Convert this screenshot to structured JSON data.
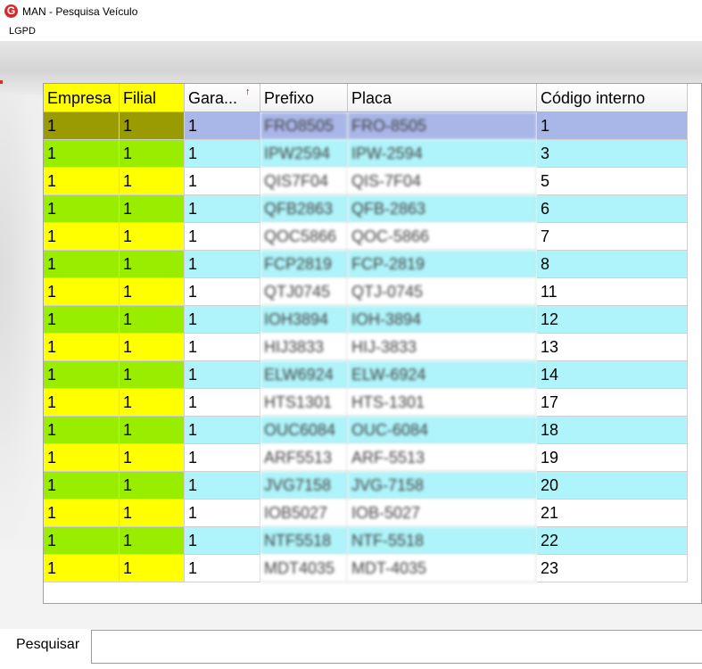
{
  "window": {
    "title": "MAN - Pesquisa Veículo",
    "icon": "app-logo-icon"
  },
  "menu": {
    "items": [
      "LGPD"
    ]
  },
  "grid": {
    "columns": [
      "Empresa",
      "Filial",
      "Gara...",
      "Prefixo",
      "Placa",
      "Código interno"
    ],
    "sorted_column": "Gara...",
    "sort_icon": "sort-ascending-icon",
    "rows": [
      {
        "empresa": "1",
        "filial": "1",
        "garagem": "1",
        "prefixo": "FRO8505",
        "placa": "FRO-8505",
        "codigo": "1"
      },
      {
        "empresa": "1",
        "filial": "1",
        "garagem": "1",
        "prefixo": "IPW2594",
        "placa": "IPW-2594",
        "codigo": "3"
      },
      {
        "empresa": "1",
        "filial": "1",
        "garagem": "1",
        "prefixo": "QIS7F04",
        "placa": "QIS-7F04",
        "codigo": "5"
      },
      {
        "empresa": "1",
        "filial": "1",
        "garagem": "1",
        "prefixo": "QFB2863",
        "placa": "QFB-2863",
        "codigo": "6"
      },
      {
        "empresa": "1",
        "filial": "1",
        "garagem": "1",
        "prefixo": "QOC5866",
        "placa": "QOC-5866",
        "codigo": "7"
      },
      {
        "empresa": "1",
        "filial": "1",
        "garagem": "1",
        "prefixo": "FCP2819",
        "placa": "FCP-2819",
        "codigo": "8"
      },
      {
        "empresa": "1",
        "filial": "1",
        "garagem": "1",
        "prefixo": "QTJ0745",
        "placa": "QTJ-0745",
        "codigo": "11"
      },
      {
        "empresa": "1",
        "filial": "1",
        "garagem": "1",
        "prefixo": "IOH3894",
        "placa": "IOH-3894",
        "codigo": "12"
      },
      {
        "empresa": "1",
        "filial": "1",
        "garagem": "1",
        "prefixo": "HIJ3833",
        "placa": "HIJ-3833",
        "codigo": "13"
      },
      {
        "empresa": "1",
        "filial": "1",
        "garagem": "1",
        "prefixo": "ELW6924",
        "placa": "ELW-6924",
        "codigo": "14"
      },
      {
        "empresa": "1",
        "filial": "1",
        "garagem": "1",
        "prefixo": "HTS1301",
        "placa": "HTS-1301",
        "codigo": "17"
      },
      {
        "empresa": "1",
        "filial": "1",
        "garagem": "1",
        "prefixo": "OUC6084",
        "placa": "OUC-6084",
        "codigo": "18"
      },
      {
        "empresa": "1",
        "filial": "1",
        "garagem": "1",
        "prefixo": "ARF5513",
        "placa": "ARF-5513",
        "codigo": "19"
      },
      {
        "empresa": "1",
        "filial": "1",
        "garagem": "1",
        "prefixo": "JVG7158",
        "placa": "JVG-7158",
        "codigo": "20"
      },
      {
        "empresa": "1",
        "filial": "1",
        "garagem": "1",
        "prefixo": "IOB5027",
        "placa": "IOB-5027",
        "codigo": "21"
      },
      {
        "empresa": "1",
        "filial": "1",
        "garagem": "1",
        "prefixo": "NTF5518",
        "placa": "NTF-5518",
        "codigo": "22"
      },
      {
        "empresa": "1",
        "filial": "1",
        "garagem": "1",
        "prefixo": "MDT4035",
        "placa": "MDT-4035",
        "codigo": "23"
      }
    ],
    "selected_row": 0,
    "colors": {
      "left_even": "#ffff00",
      "left_odd": "#99ee00",
      "right_odd": "#aef4fa",
      "right_even": "#ffffff",
      "selected_left": "#999b00",
      "selected_right": "#a9b6e8"
    }
  },
  "search": {
    "label": "Pesquisar",
    "value": ""
  }
}
